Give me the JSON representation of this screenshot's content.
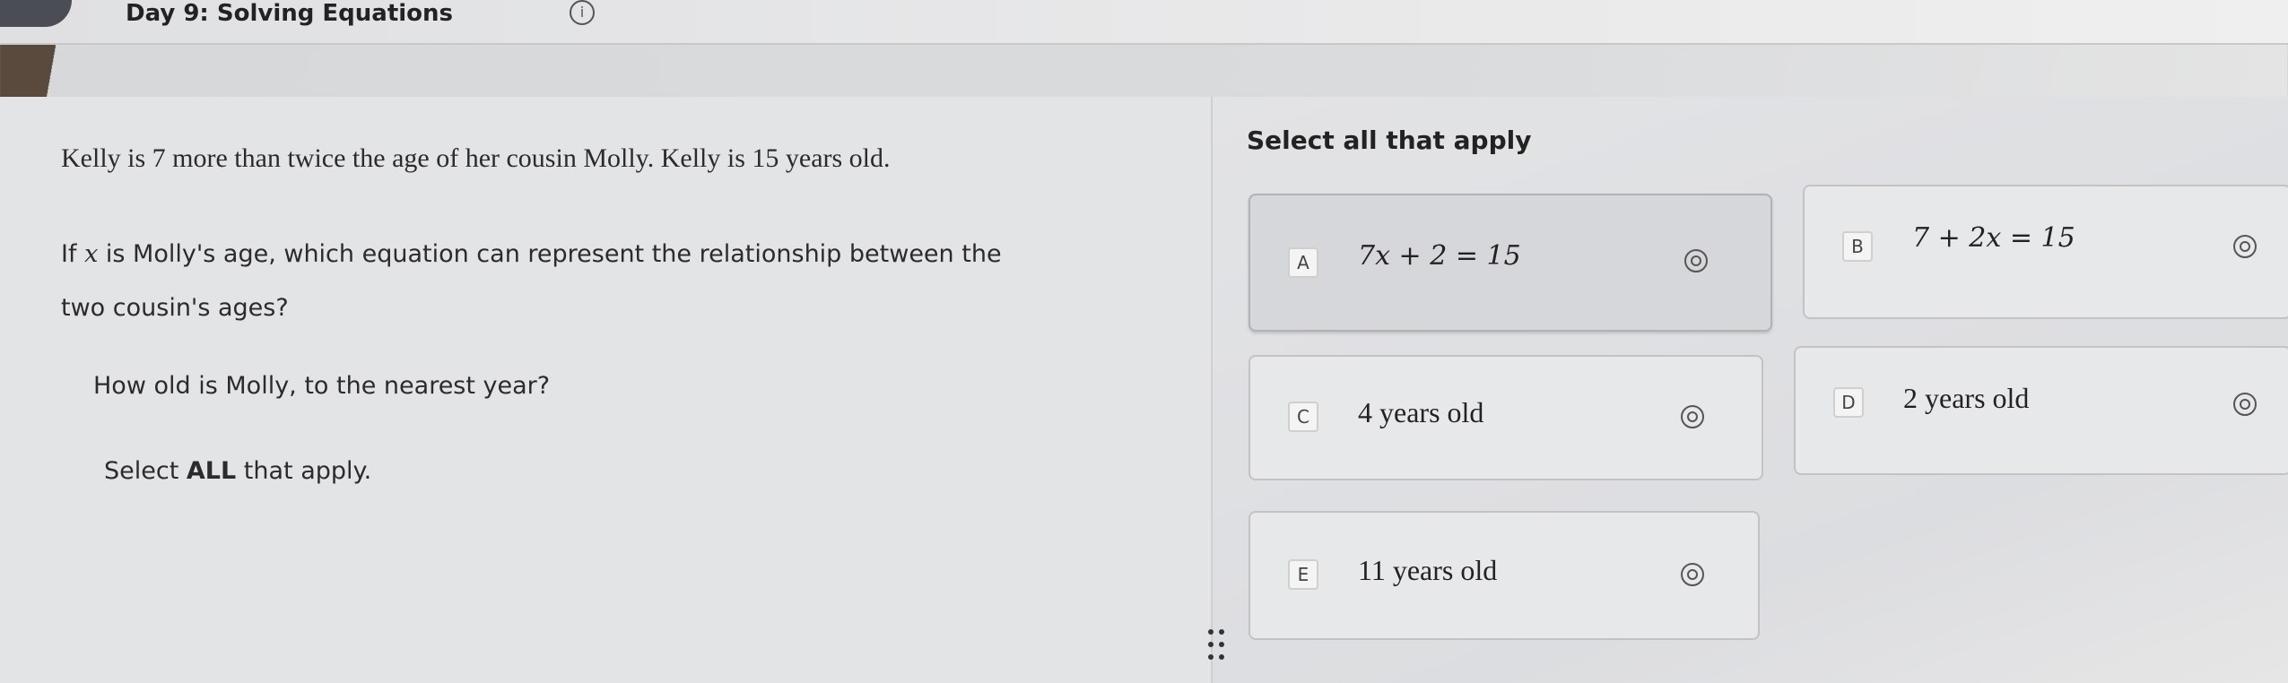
{
  "header": {
    "title": "Day 9: Solving Equations",
    "info_icon": "info-icon",
    "info_glyph": "i"
  },
  "question": {
    "line1": "Kelly is 7 more than twice the age of her cousin Molly. Kelly is 15 years old.",
    "line2_prefix": "If ",
    "line2_var": "x",
    "line2_suffix": " is Molly's age, which equation can represent the relationship between the",
    "line3": "two cousin's ages?",
    "line4": "How old is Molly, to the nearest year?",
    "line5_prefix": "Select ",
    "line5_bold": "ALL",
    "line5_suffix": " that apply."
  },
  "answers": {
    "instruction": "Select all that apply",
    "options": [
      {
        "letter": "A",
        "text": "7x + 2 = 15",
        "selected": true
      },
      {
        "letter": "B",
        "text": "7 + 2x = 15",
        "selected": false
      },
      {
        "letter": "C",
        "text": "4 years old",
        "selected": false
      },
      {
        "letter": "D",
        "text": "2 years old",
        "selected": false
      },
      {
        "letter": "E",
        "text": "11 years old",
        "selected": false
      }
    ]
  },
  "icons": {
    "option_icon": "eye-icon",
    "drag_icon": "drag-handle-icon"
  }
}
